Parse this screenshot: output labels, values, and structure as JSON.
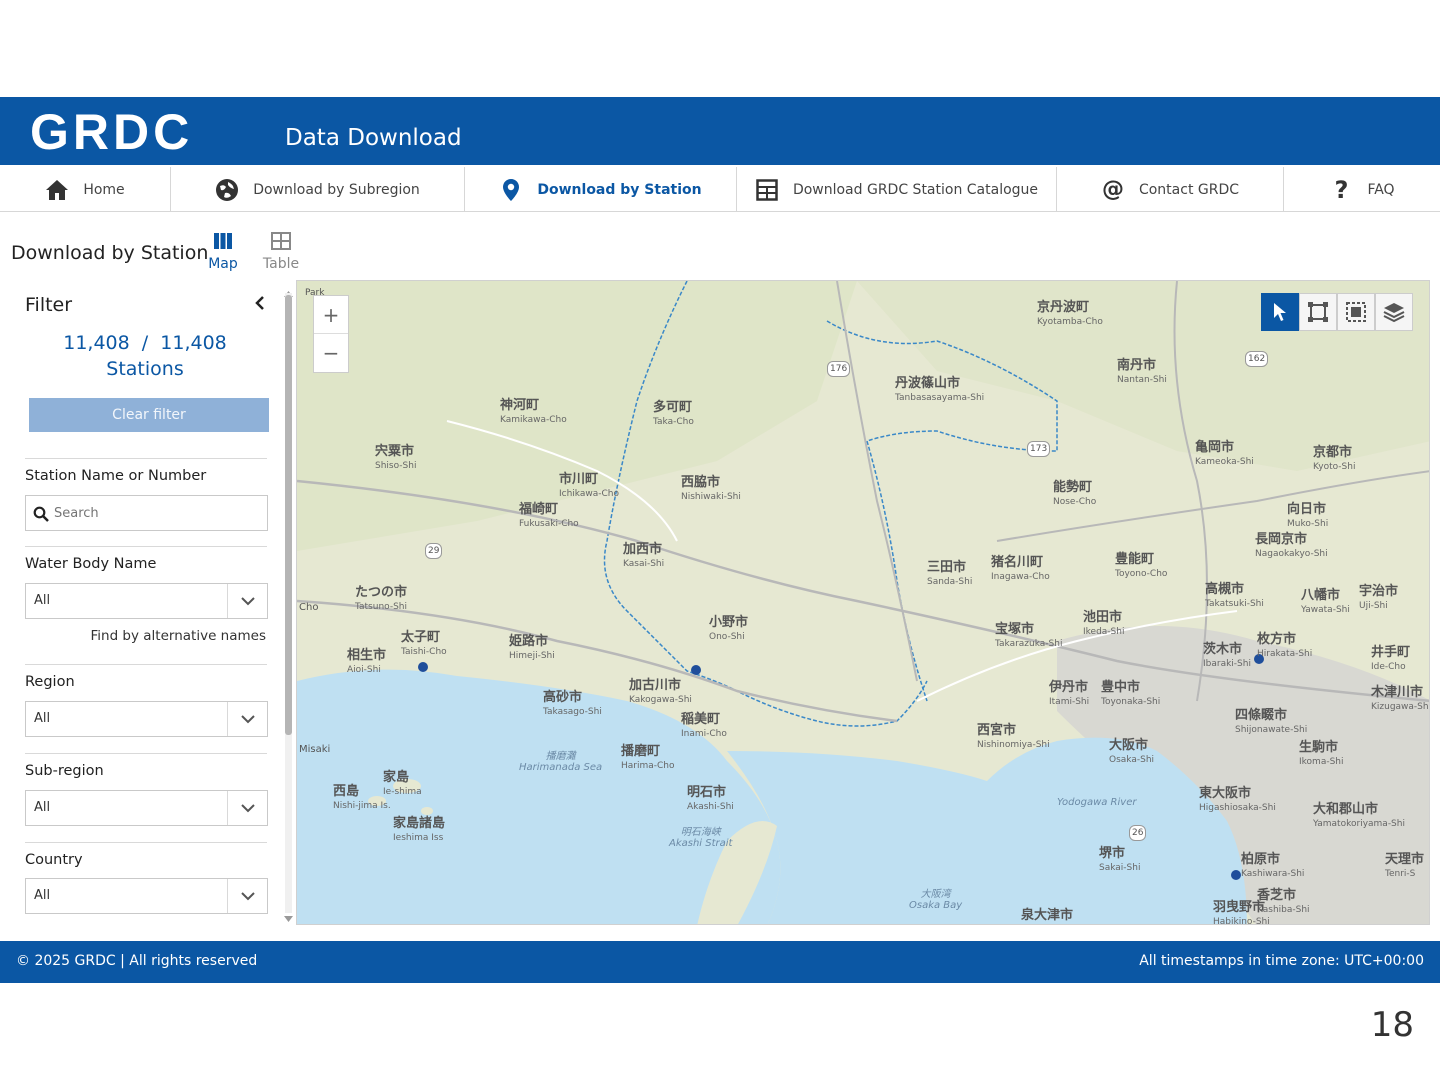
{
  "header": {
    "logo": "GRDC",
    "title": "Data Download"
  },
  "nav": {
    "items": [
      {
        "label": "Home",
        "icon": "home-icon"
      },
      {
        "label": "Download by Subregion",
        "icon": "globe-icon"
      },
      {
        "label": "Download by Station",
        "icon": "map-pin-icon",
        "active": true
      },
      {
        "label": "Download GRDC Station Catalogue",
        "icon": "table-icon"
      },
      {
        "label": "Contact GRDC",
        "icon": "at-icon"
      },
      {
        "label": "FAQ",
        "icon": "question-icon"
      }
    ]
  },
  "page": {
    "title": "Download by Station",
    "view_tabs": [
      {
        "label": "Map",
        "icon": "map-columns-icon",
        "active": true
      },
      {
        "label": "Table",
        "icon": "table-icon",
        "active": false
      }
    ]
  },
  "filter": {
    "heading": "Filter",
    "count_text": "11,408  /  11,408",
    "count_unit": "Stations",
    "clear_label": "Clear filter",
    "station_label": "Station Name or Number",
    "search_placeholder": "Search",
    "water_body_label": "Water Body Name",
    "water_body_value": "All",
    "alt_names_link": "Find by alternative names",
    "region_label": "Region",
    "region_value": "All",
    "subregion_label": "Sub-region",
    "subregion_value": "All",
    "country_label": "Country",
    "country_value": "All"
  },
  "map": {
    "zoom_in": "+",
    "zoom_out": "−",
    "tools": [
      "select-pointer-icon",
      "box-select-icon",
      "lasso-select-icon",
      "layers-icon"
    ],
    "colors": {
      "land": "#e9ead6",
      "water": "#bfe0f2",
      "boundary": "#3a88c8",
      "station": "#1f4e9b"
    },
    "places": [
      {
        "name": "京丹波町",
        "romaji": "Kyotamba-Cho"
      },
      {
        "name": "南丹市",
        "romaji": "Nantan-Shi"
      },
      {
        "name": "丹波篠山市",
        "romaji": "Tanbasasayama-Shi"
      },
      {
        "name": "神河町",
        "romaji": "Kamikawa-Cho"
      },
      {
        "name": "多可町",
        "romaji": "Taka-Cho"
      },
      {
        "name": "宍粟市",
        "romaji": "Shiso-Shi"
      },
      {
        "name": "市川町",
        "romaji": "Ichikawa-Cho"
      },
      {
        "name": "福崎町",
        "romaji": "Fukusaki-Cho"
      },
      {
        "name": "西脇市",
        "romaji": "Nishiwaki-Shi"
      },
      {
        "name": "亀岡市",
        "romaji": "Kameoka-Shi"
      },
      {
        "name": "京都市",
        "romaji": "Kyoto-Shi"
      },
      {
        "name": "能勢町",
        "romaji": "Nose-Cho"
      },
      {
        "name": "向日市",
        "romaji": "Muko-Shi"
      },
      {
        "name": "長岡京市",
        "romaji": "Nagaokakyo-Shi"
      },
      {
        "name": "加西市",
        "romaji": "Kasai-Shi"
      },
      {
        "name": "三田市",
        "romaji": "Sanda-Shi"
      },
      {
        "name": "猪名川町",
        "romaji": "Inagawa-Cho"
      },
      {
        "name": "豊能町",
        "romaji": "Toyono-Cho"
      },
      {
        "name": "たつの市",
        "romaji": "Tatsuno-Shi"
      },
      {
        "name": "高槻市",
        "romaji": "Takatsuki-Shi"
      },
      {
        "name": "八幡市",
        "romaji": "Yawata-Shi"
      },
      {
        "name": "宇治市",
        "romaji": "Uji-Shi"
      },
      {
        "name": "小野市",
        "romaji": "Ono-Shi"
      },
      {
        "name": "池田市",
        "romaji": "Ikeda-Shi"
      },
      {
        "name": "宝塚市",
        "romaji": "Takarazuka-Shi"
      },
      {
        "name": "茨木市",
        "romaji": "Ibaraki-Shi"
      },
      {
        "name": "枚方市",
        "romaji": "Hirakata-Shi"
      },
      {
        "name": "井手町",
        "romaji": "Ide-Cho"
      },
      {
        "name": "太子町",
        "romaji": "Taishi-Cho"
      },
      {
        "name": "姫路市",
        "romaji": "Himeji-Shi"
      },
      {
        "name": "相生市",
        "romaji": "Aioi-Shi"
      },
      {
        "name": "加古川市",
        "romaji": "Kakogawa-Shi"
      },
      {
        "name": "伊丹市",
        "romaji": "Itami-Shi"
      },
      {
        "name": "豊中市",
        "romaji": "Toyonaka-Shi"
      },
      {
        "name": "木津川市",
        "romaji": "Kizugawa-Shi"
      },
      {
        "name": "高砂市",
        "romaji": "Takasago-Shi"
      },
      {
        "name": "稲美町",
        "romaji": "Inami-Cho"
      },
      {
        "name": "西宮市",
        "romaji": "Nishinomiya-Shi"
      },
      {
        "name": "四條畷市",
        "romaji": "Shijonawate-Shi"
      },
      {
        "name": "播磨町",
        "romaji": "Harima-Cho"
      },
      {
        "name": "大阪市",
        "romaji": "Osaka-Shi"
      },
      {
        "name": "生駒市",
        "romaji": "Ikoma-Shi"
      },
      {
        "name": "家島",
        "romaji": "Ie-shima"
      },
      {
        "name": "西島",
        "romaji": "Nishi-jima Is."
      },
      {
        "name": "明石市",
        "romaji": "Akashi-Shi"
      },
      {
        "name": "東大阪市",
        "romaji": "Higashiosaka-Shi"
      },
      {
        "name": "家島諸島",
        "romaji": "Ieshima Iss"
      },
      {
        "name": "大和郡山市",
        "romaji": "Yamatokoriyama-Shi"
      },
      {
        "name": "堺市",
        "romaji": "Sakai-Shi"
      },
      {
        "name": "柏原市",
        "romaji": "Kashiwara-Shi"
      },
      {
        "name": "天理市",
        "romaji": "Tenri-S"
      },
      {
        "name": "香芝市",
        "romaji": "Kashiba-Shi"
      },
      {
        "name": "泉大津市",
        "romaji": ""
      },
      {
        "name": "羽曳野市",
        "romaji": "Habikino-Shi"
      }
    ],
    "sea_labels": [
      {
        "name": "播磨灘",
        "romaji": "Harimanada Sea"
      },
      {
        "name": "明石海峡",
        "romaji": "Akashi Strait"
      },
      {
        "name": "大阪湾",
        "romaji": "Osaka Bay"
      },
      {
        "name": "",
        "romaji": "Yodogawa River"
      }
    ],
    "edge_fragments": [
      "Misaki",
      "Cho",
      "Park"
    ],
    "route_numbers": [
      "176",
      "162",
      "173",
      "29",
      "26"
    ]
  },
  "footer": {
    "copyright": "© 2025 GRDC | All rights reserved",
    "timezone": "All timestamps in time zone: UTC+00:00"
  },
  "slide_number": "18"
}
